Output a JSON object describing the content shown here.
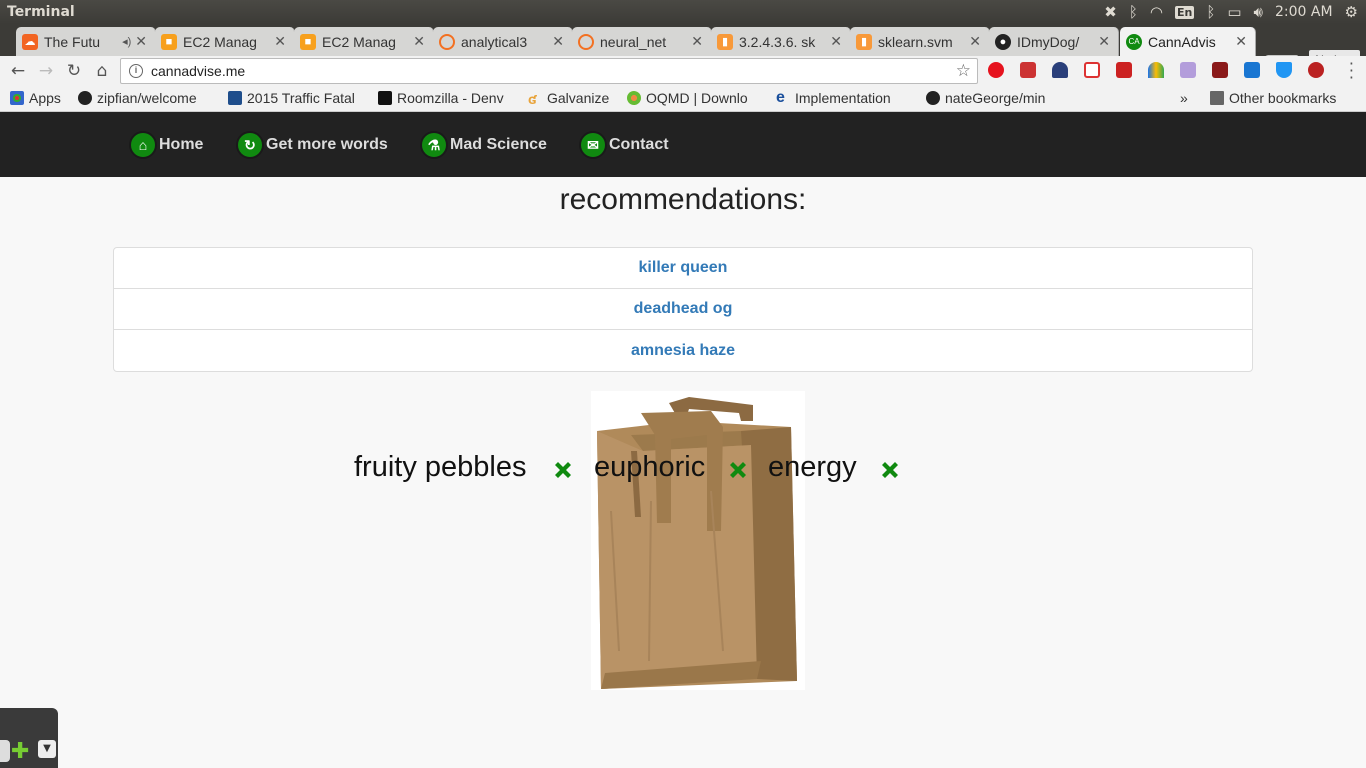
{
  "os": {
    "app_title": "Terminal",
    "lang": "En",
    "clock": "2:00 AM"
  },
  "browser": {
    "tabs": [
      {
        "label": "The Futu",
        "color": "#f26522"
      },
      {
        "label": "EC2 Manag",
        "color": "#f7a01d"
      },
      {
        "label": "EC2 Manag",
        "color": "#f7a01d"
      },
      {
        "label": "analytical3",
        "color": "#f37021"
      },
      {
        "label": "neural_net",
        "color": "#f37021"
      },
      {
        "label": "3.2.4.3.6. sk",
        "color": "#3399ff"
      },
      {
        "label": "sklearn.svm",
        "color": "#3399ff"
      },
      {
        "label": "IDmyDog/",
        "color": "#222222"
      },
      {
        "label": "CannAdvis",
        "color": "#108a10"
      }
    ],
    "profile_name": "Nathan",
    "url": "cannadvise.me",
    "bookmarks": [
      {
        "label": "Apps"
      },
      {
        "label": "zipfian/welcome"
      },
      {
        "label": "2015 Traffic Fatal"
      },
      {
        "label": "Roomzilla - Denv"
      },
      {
        "label": "Galvanize"
      },
      {
        "label": "OQMD | Downlo"
      },
      {
        "label": "Implementation"
      },
      {
        "label": "nateGeorge/min"
      }
    ],
    "overflow": "»",
    "other_bookmarks": "Other bookmarks"
  },
  "site_nav": {
    "home": "Home",
    "more_words": "Get more words",
    "mad_science": "Mad Science",
    "contact": "Contact"
  },
  "main": {
    "title": "recommendations:",
    "recommendations": [
      "killer queen",
      "deadhead og",
      "amnesia haze"
    ],
    "words": [
      "fruity pebbles",
      "euphoric",
      "energy"
    ]
  },
  "colors": {
    "accent_green": "#108a10",
    "link_blue": "#337ab7",
    "navbar": "#222222"
  }
}
